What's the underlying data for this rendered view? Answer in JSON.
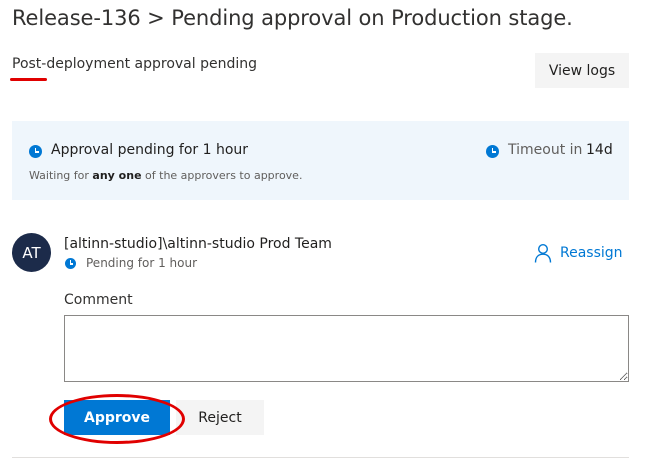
{
  "header": {
    "title": "Release-136 > Pending approval on Production stage.",
    "subtitle": "Post-deployment approval pending",
    "view_logs_label": "View logs"
  },
  "banner": {
    "title": "Approval pending for 1 hour",
    "subtitle_prefix": "Waiting for ",
    "subtitle_bold": "any one",
    "subtitle_suffix": " of the approvers to approve.",
    "timeout_label": "Timeout in",
    "timeout_value": "14d"
  },
  "approver": {
    "initials": "AT",
    "name": "[altinn-studio]\\altinn-studio Prod Team",
    "status": "Pending for 1 hour",
    "reassign_label": "Reassign"
  },
  "comment": {
    "label": "Comment",
    "value": ""
  },
  "actions": {
    "approve_label": "Approve",
    "reject_label": "Reject"
  },
  "colors": {
    "accent": "#0078d4",
    "banner_bg": "#eff6fc",
    "avatar_bg": "#1c2b4a",
    "annotation": "#e00000"
  },
  "icons": {
    "clock": "clock-icon",
    "person": "person-icon"
  }
}
